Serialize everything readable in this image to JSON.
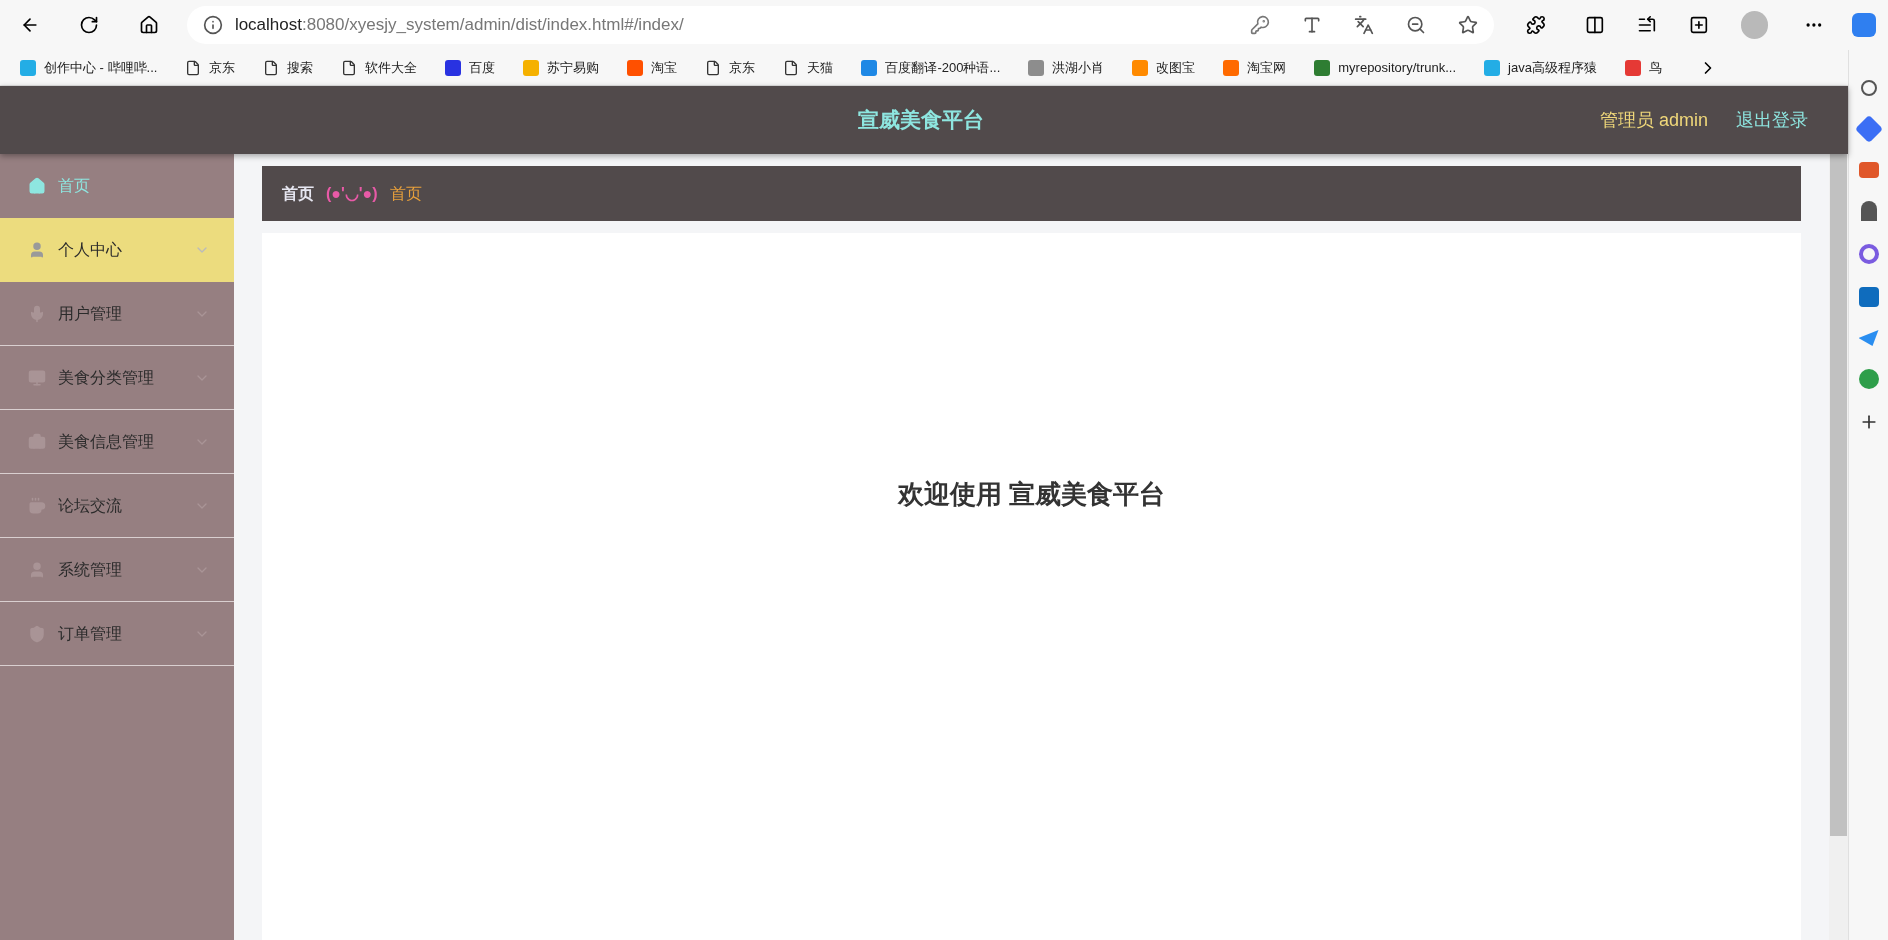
{
  "browser": {
    "url_host": "localhost",
    "url_rest": ":8080/xyesjy_system/admin/dist/index.html#/index/",
    "bookmarks": [
      {
        "label": "创作中心 - 哔哩哔...",
        "kind": "site",
        "color": "#23ade5"
      },
      {
        "label": "京东",
        "kind": "page"
      },
      {
        "label": "搜索",
        "kind": "page"
      },
      {
        "label": "软件大全",
        "kind": "page"
      },
      {
        "label": "百度",
        "kind": "site",
        "color": "#2932e1"
      },
      {
        "label": "苏宁易购",
        "kind": "site",
        "color": "#f5b100"
      },
      {
        "label": "淘宝",
        "kind": "site",
        "color": "#ff5000"
      },
      {
        "label": "京东",
        "kind": "page"
      },
      {
        "label": "天猫",
        "kind": "page"
      },
      {
        "label": "百度翻译-200种语...",
        "kind": "site",
        "color": "#1e88e5"
      },
      {
        "label": "洪湖小肖",
        "kind": "site",
        "color": "#8d8d8d"
      },
      {
        "label": "改图宝",
        "kind": "site",
        "color": "#ff8a00"
      },
      {
        "label": "淘宝网",
        "kind": "site",
        "color": "#ff6a00"
      },
      {
        "label": "myrepository/trunk...",
        "kind": "site",
        "color": "#2e7d32"
      },
      {
        "label": "java高级程序猿",
        "kind": "site",
        "color": "#23ade5"
      },
      {
        "label": "鸟",
        "kind": "site",
        "color": "#e53935"
      }
    ]
  },
  "header": {
    "title": "宣威美食平台",
    "user": "管理员 admin",
    "logout": "退出登录"
  },
  "sidebar": {
    "items": [
      {
        "label": "首页",
        "kind": "link",
        "selected": true,
        "hovered": false
      },
      {
        "label": "个人中心",
        "kind": "submenu",
        "selected": false,
        "hovered": true
      },
      {
        "label": "用户管理",
        "kind": "submenu",
        "selected": false,
        "hovered": false
      },
      {
        "label": "美食分类管理",
        "kind": "submenu",
        "selected": false,
        "hovered": false
      },
      {
        "label": "美食信息管理",
        "kind": "submenu",
        "selected": false,
        "hovered": false
      },
      {
        "label": "论坛交流",
        "kind": "submenu",
        "selected": false,
        "hovered": false
      },
      {
        "label": "系统管理",
        "kind": "submenu",
        "selected": false,
        "hovered": false
      },
      {
        "label": "订单管理",
        "kind": "submenu",
        "selected": false,
        "hovered": false
      }
    ]
  },
  "breadcrumb": {
    "root": "首页",
    "face": "(●'◡'●)",
    "current": "首页"
  },
  "welcome": "欢迎使用 宣威美食平台"
}
